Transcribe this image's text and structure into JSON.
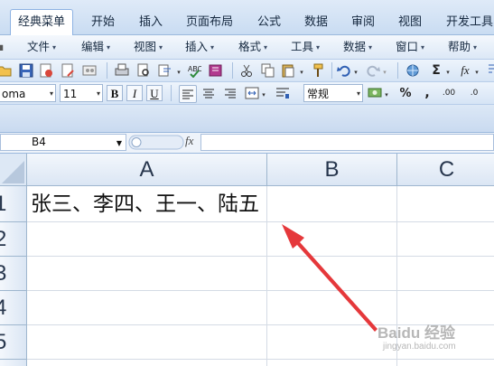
{
  "ribbon_tabs": [
    {
      "label": "经典菜单",
      "active": true
    },
    {
      "label": "开始",
      "active": false
    },
    {
      "label": "插入",
      "active": false
    },
    {
      "label": "页面布局",
      "active": false
    },
    {
      "label": "公式",
      "active": false
    },
    {
      "label": "数据",
      "active": false
    },
    {
      "label": "审阅",
      "active": false
    },
    {
      "label": "视图",
      "active": false
    },
    {
      "label": "开发工具",
      "active": false
    }
  ],
  "menu_items": [
    {
      "label": "文件"
    },
    {
      "label": "编辑"
    },
    {
      "label": "视图"
    },
    {
      "label": "插入"
    },
    {
      "label": "格式"
    },
    {
      "label": "工具"
    },
    {
      "label": "数据"
    },
    {
      "label": "窗口"
    },
    {
      "label": "帮助"
    }
  ],
  "toolbar": {
    "font_name": "oma",
    "font_size": "11",
    "bold": "B",
    "italic": "I",
    "underline": "U",
    "number_format": "常规",
    "percent": "%",
    "comma": ",",
    "sum_symbol": "Σ",
    "fx_symbol": "fx",
    "inc_decimal": ".00",
    "dec_decimal": ".0"
  },
  "formula_bar": {
    "name_box": "B4",
    "fx_label": "fx",
    "formula": ""
  },
  "grid": {
    "columns": [
      "A",
      "B",
      "C"
    ],
    "rows": [
      "1",
      "2",
      "3",
      "4",
      "5"
    ],
    "a1_value": "张三、李四、王一、陆五",
    "selected_cell": "B4"
  },
  "annotation": {
    "arrow_color": "#e5383b"
  },
  "watermark": {
    "text": "Baidu 经验",
    "subtext": "jingyan.baidu.com"
  }
}
